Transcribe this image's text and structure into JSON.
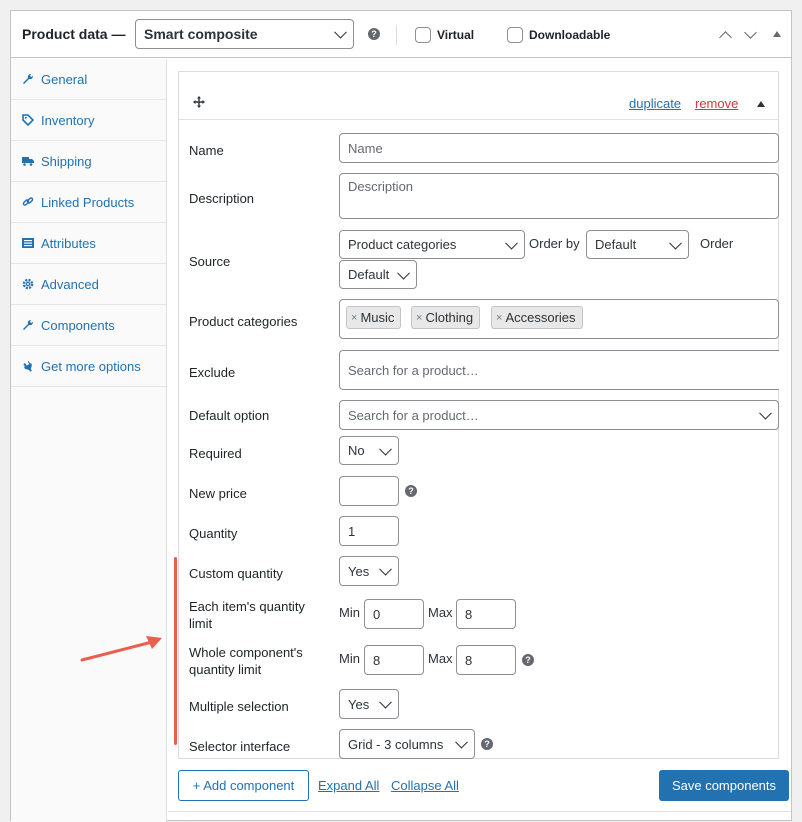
{
  "header": {
    "title": "Product data —",
    "product_type": "Smart composite",
    "virtual_label": "Virtual",
    "downloadable_label": "Downloadable",
    "help_glyph": "?"
  },
  "sidebar": {
    "items": [
      {
        "label": "General",
        "icon": "wrench-icon"
      },
      {
        "label": "Inventory",
        "icon": "tag-icon"
      },
      {
        "label": "Shipping",
        "icon": "truck-icon"
      },
      {
        "label": "Linked Products",
        "icon": "link-icon"
      },
      {
        "label": "Attributes",
        "icon": "list-icon"
      },
      {
        "label": "Advanced",
        "icon": "gear-icon"
      },
      {
        "label": "Components",
        "icon": "wrench-icon"
      },
      {
        "label": "Get more options",
        "icon": "plugin-icon"
      }
    ]
  },
  "component": {
    "duplicate_label": "duplicate",
    "remove_label": "remove",
    "fields": {
      "name": {
        "label": "Name",
        "placeholder": "Name"
      },
      "description": {
        "label": "Description",
        "placeholder": "Description"
      },
      "source": {
        "label": "Source",
        "value": "Product categories",
        "order_by_label": "Order by",
        "order_by_value": "Default",
        "order_label": "Order",
        "order_value": "Default"
      },
      "product_categories": {
        "label": "Product categories",
        "tags": [
          "Music",
          "Clothing",
          "Accessories"
        ],
        "remove_glyph": "×"
      },
      "exclude": {
        "label": "Exclude",
        "placeholder": "Search for a product…"
      },
      "default_option": {
        "label": "Default option",
        "placeholder": "Search for a product…"
      },
      "required": {
        "label": "Required",
        "value": "No"
      },
      "new_price": {
        "label": "New price",
        "value": ""
      },
      "quantity": {
        "label": "Quantity",
        "value": "1"
      },
      "custom_quantity": {
        "label": "Custom quantity",
        "value": "Yes"
      },
      "each_item_limit": {
        "label_line1": "Each item's quantity",
        "label_line2": "limit",
        "min_label": "Min",
        "min_value": "0",
        "max_label": "Max",
        "max_value": "8"
      },
      "whole_component_limit": {
        "label_line1": "Whole component's",
        "label_line2": "quantity limit",
        "min_label": "Min",
        "min_value": "8",
        "max_label": "Max",
        "max_value": "8"
      },
      "multiple_selection": {
        "label": "Multiple selection",
        "value": "Yes"
      },
      "selector_interface": {
        "label": "Selector interface",
        "value": "Grid - 3 columns"
      }
    }
  },
  "footer": {
    "add_component": "+ Add component",
    "expand_all": "Expand All",
    "collapse_all": "Collapse All",
    "save_components": "Save components"
  },
  "colors": {
    "accent": "#2271b1",
    "remove": "#d63638",
    "annotation": "#e8604c"
  }
}
